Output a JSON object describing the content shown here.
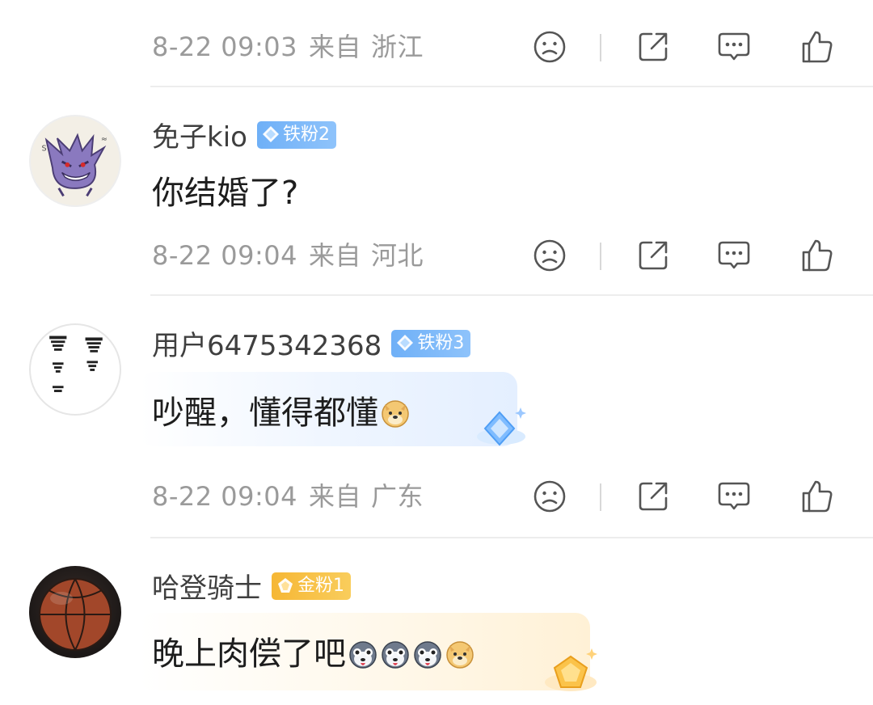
{
  "colors": {
    "meta_text": "#9a9a9a",
    "divider": "#ededed",
    "badge_blue": "#7ab6f8",
    "badge_gold": "#f7c04a"
  },
  "icons": {
    "dislike": "sad-face-icon",
    "share": "share-icon",
    "comment": "comment-icon",
    "like": "thumbs-up-icon"
  },
  "top_meta": {
    "time": "8-22 09:03",
    "from_label": "来自",
    "location": "浙江"
  },
  "comments": [
    {
      "username": "免子kio",
      "badge": "铁粉2",
      "text": "你结婚了?",
      "time": "8-22 09:04",
      "from_label": "来自",
      "location": "河北"
    },
    {
      "username": "用户6475342368",
      "badge": "铁粉3",
      "text": "吵醒，懂得都懂",
      "time": "8-22 09:04",
      "from_label": "来自",
      "location": "广东"
    },
    {
      "username": "哈登骑士",
      "badge": "金粉1",
      "text": "晚上肉偿了吧"
    }
  ]
}
